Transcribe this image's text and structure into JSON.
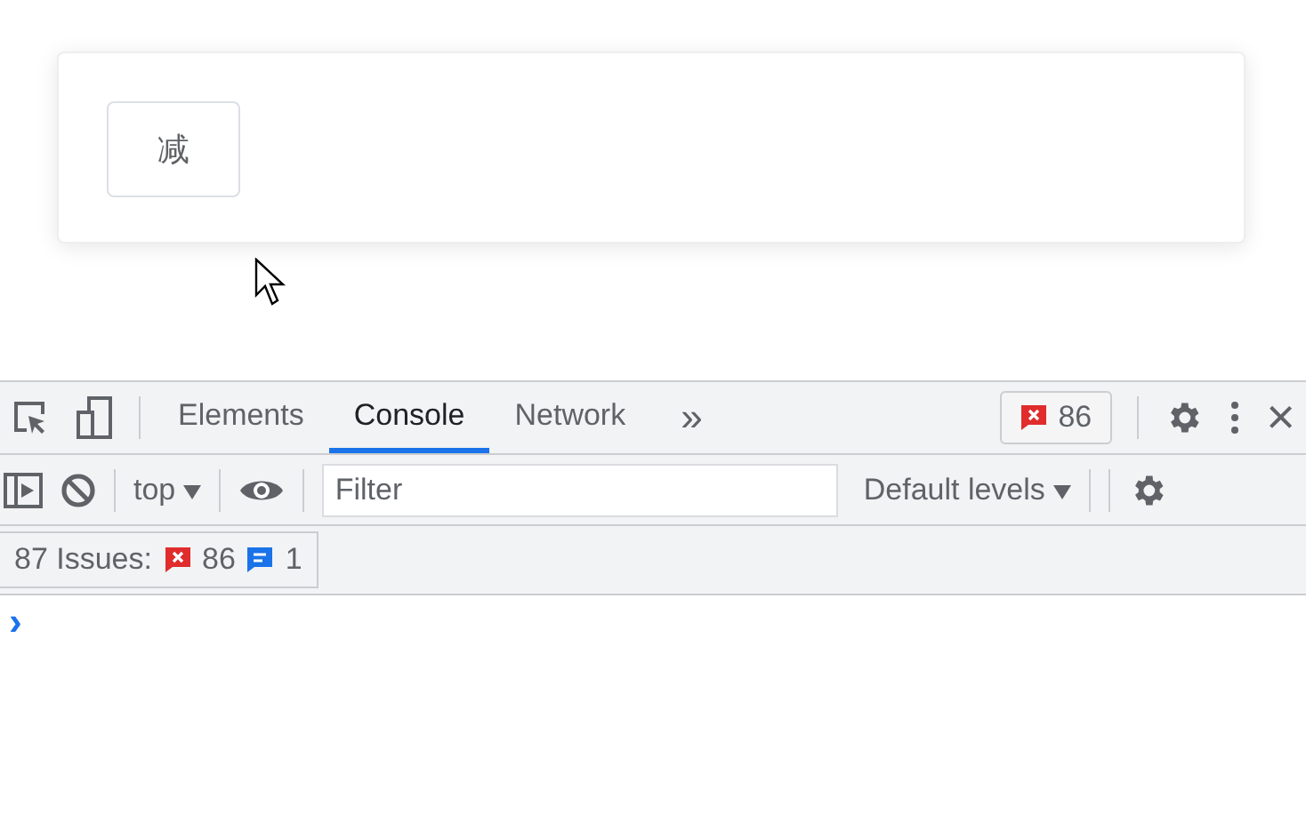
{
  "page": {
    "button": "减"
  },
  "devtools": {
    "tabs": [
      {
        "label": "Elements",
        "selected": false
      },
      {
        "label": "Console",
        "selected": true
      },
      {
        "label": "Network",
        "selected": false
      }
    ],
    "more": "»",
    "error_badge": "86",
    "close": "×",
    "console_toolbar": {
      "context": "top",
      "filter": {
        "placeholder": "Filter"
      },
      "levels": "Default levels"
    },
    "issues": {
      "label": "87 Issues:",
      "errors": "86",
      "infos": "1"
    },
    "prompt": "›"
  }
}
